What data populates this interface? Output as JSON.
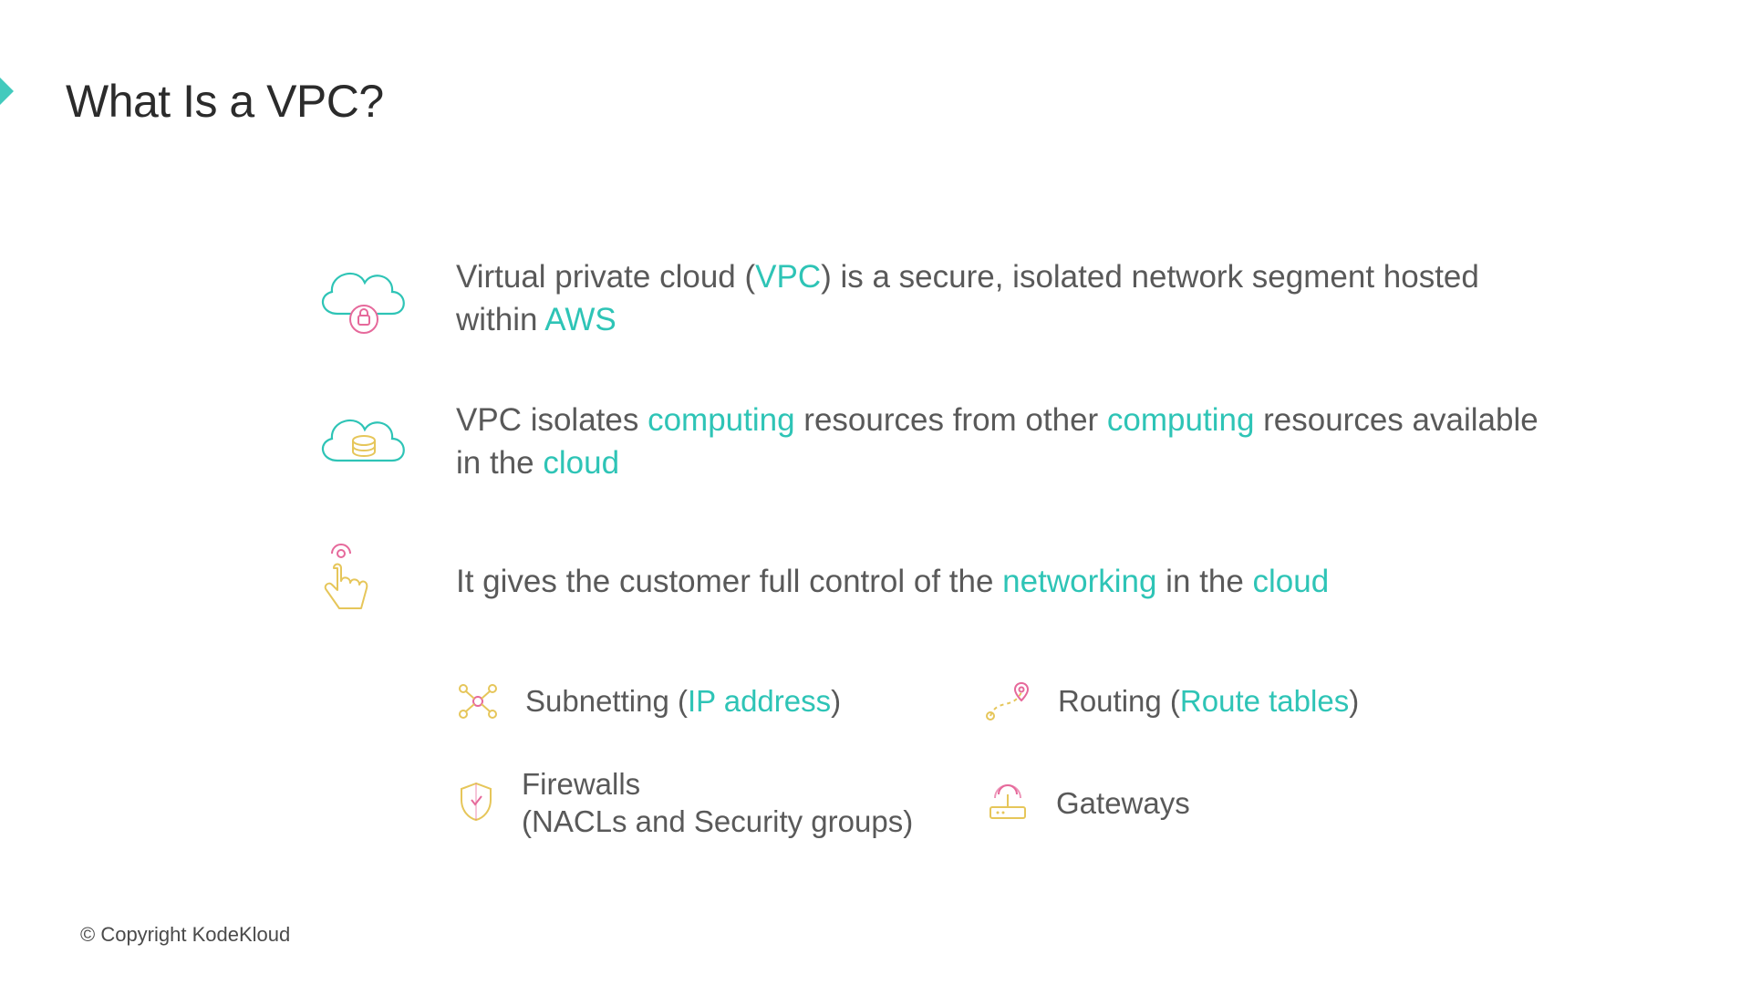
{
  "title": "What Is a VPC?",
  "bullets": {
    "b1": {
      "t1": "Virtual private cloud (",
      "h1": "VPC",
      "t2": ") is a secure, isolated network segment hosted within ",
      "h2": "AWS"
    },
    "b2": {
      "t1": "VPC isolates ",
      "h1": "computing",
      "t2": " resources from other ",
      "h2": "computing",
      "t3": " resources available in the ",
      "h3": "cloud"
    },
    "b3": {
      "t1": "It gives the customer full control of the ",
      "h1": "networking",
      "t2": " in the ",
      "h2": "cloud"
    }
  },
  "sub": {
    "s1": {
      "a": "Subnetting (",
      "h": "IP address",
      "b": ")"
    },
    "s2": {
      "a": "Routing (",
      "h": "Route tables",
      "b": ")"
    },
    "s3": {
      "line1": "Firewalls",
      "line2": "(NACLs and Security groups)"
    },
    "s4": {
      "a": "Gateways"
    }
  },
  "footer": "© Copyright KodeKloud",
  "colors": {
    "accent": "#2EC4B6",
    "pink": "#E6699B",
    "gold": "#E6C65A"
  }
}
